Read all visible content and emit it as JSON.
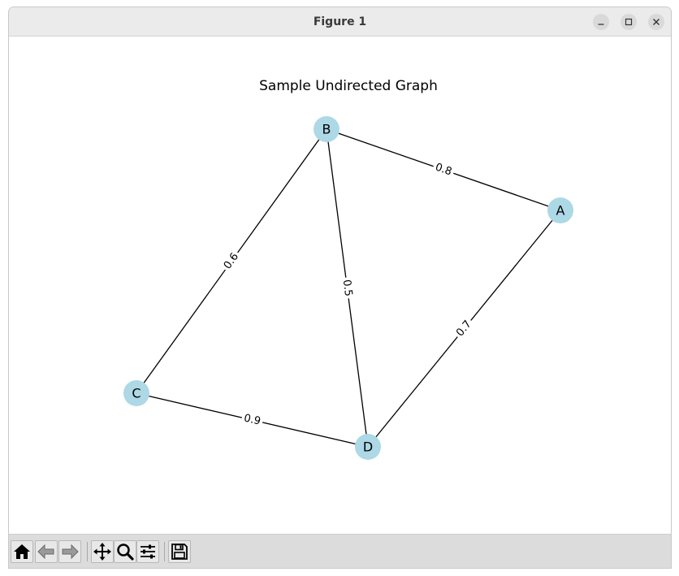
{
  "window": {
    "title": "Figure 1"
  },
  "figure": {
    "title": "Sample Undirected Graph",
    "node_color": "#add8e6",
    "edge_color": "#000000"
  },
  "chart_data": {
    "type": "graph",
    "title": "Sample Undirected Graph",
    "directed": false,
    "nodes": [
      "A",
      "B",
      "C",
      "D"
    ],
    "edges": [
      {
        "source": "B",
        "target": "A",
        "weight": "0.8"
      },
      {
        "source": "B",
        "target": "C",
        "weight": "0.6"
      },
      {
        "source": "B",
        "target": "D",
        "weight": "0.5"
      },
      {
        "source": "A",
        "target": "D",
        "weight": "0.7"
      },
      {
        "source": "C",
        "target": "D",
        "weight": "0.9"
      }
    ]
  },
  "toolbar": {
    "buttons": [
      {
        "name": "home",
        "icon": "home-icon"
      },
      {
        "name": "back",
        "icon": "arrow-left-icon"
      },
      {
        "name": "forward",
        "icon": "arrow-right-icon"
      },
      {
        "name": "pan",
        "icon": "move-icon"
      },
      {
        "name": "zoom",
        "icon": "magnifier-icon"
      },
      {
        "name": "configure-subplots",
        "icon": "sliders-icon"
      },
      {
        "name": "save",
        "icon": "floppy-disk-icon"
      }
    ]
  }
}
